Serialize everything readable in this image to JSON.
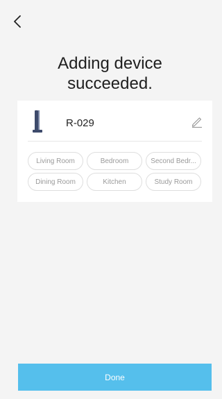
{
  "header": {
    "back_icon": "chevron-left-icon",
    "title_line1": "Adding device",
    "title_line2": "succeeded."
  },
  "device": {
    "icon": "tower-fan-icon",
    "name": "R-029",
    "edit_icon": "pencil-icon"
  },
  "rooms": [
    {
      "label": "Living Room"
    },
    {
      "label": "Bedroom"
    },
    {
      "label": "Second Bedr..."
    },
    {
      "label": "Dining Room"
    },
    {
      "label": "Kitchen"
    },
    {
      "label": "Study Room"
    }
  ],
  "footer": {
    "done_label": "Done",
    "accent_color": "#55bfec"
  }
}
